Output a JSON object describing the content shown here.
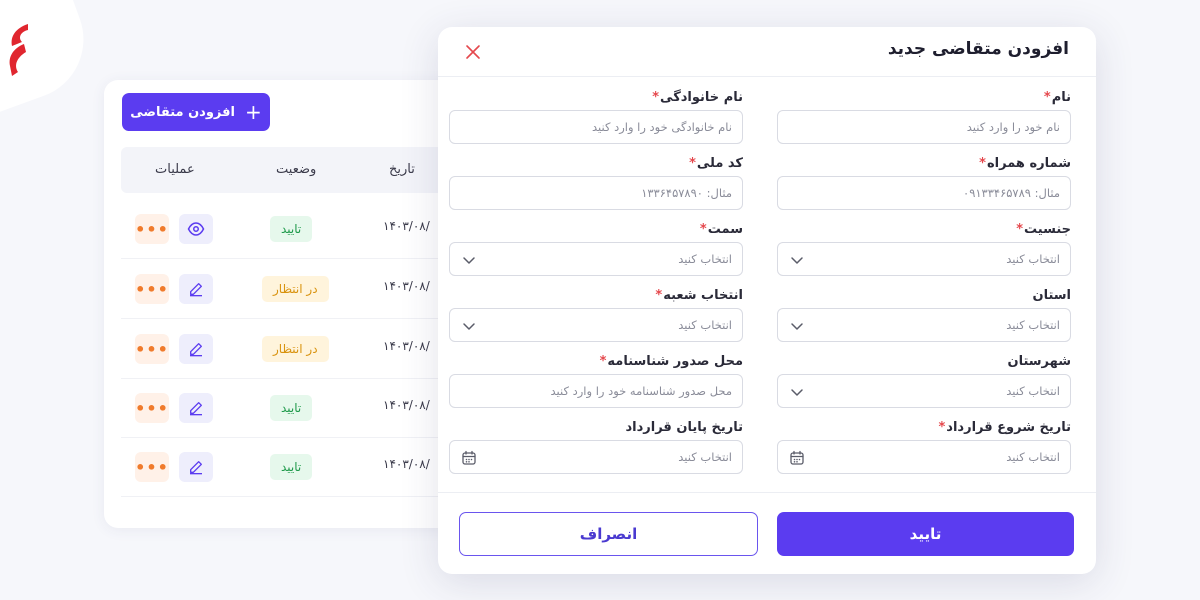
{
  "toolbar": {
    "add_label": "افزودن متقاضی"
  },
  "table": {
    "headers": {
      "ops": "عملیات",
      "status": "وضعیت",
      "date": "تاریخ"
    },
    "rows": [
      {
        "status": "تایید",
        "status_type": "ok",
        "date": "۱۴۰۳/۰۸/",
        "action_icon": "eye-icon"
      },
      {
        "status": "در انتظار",
        "status_type": "wait",
        "date": "۱۴۰۳/۰۸/",
        "action_icon": "edit-icon"
      },
      {
        "status": "در انتظار",
        "status_type": "wait",
        "date": "۱۴۰۳/۰۸/",
        "action_icon": "edit-icon"
      },
      {
        "status": "تایید",
        "status_type": "ok",
        "date": "۱۴۰۳/۰۸/",
        "action_icon": "edit-icon"
      },
      {
        "status": "تایید",
        "status_type": "ok",
        "date": "۱۴۰۳/۰۸/",
        "action_icon": "edit-icon"
      }
    ],
    "more_glyph": "•••"
  },
  "modal": {
    "title": "افزودن متقاضی جدید",
    "fields": {
      "first_name": {
        "label": "نام",
        "placeholder": "نام خود را وارد کنید"
      },
      "last_name": {
        "label": "نام خانوادگی",
        "placeholder": "نام خانوادگی خود را وارد کنید"
      },
      "mobile": {
        "label": "شماره همراه",
        "placeholder": "مثال: ۰۹۱۳۳۴۶۵۷۸۹"
      },
      "national_code": {
        "label": "کد ملی",
        "placeholder": "مثال: ۱۳۳۶۴۵۷۸۹۰"
      },
      "gender": {
        "label": "جنسیت",
        "placeholder": "انتخاب کنید"
      },
      "position": {
        "label": "سمت",
        "placeholder": "انتخاب کنید"
      },
      "province": {
        "label": "استان",
        "placeholder": "انتخاب کنید"
      },
      "branch": {
        "label": "انتخاب شعبه",
        "placeholder": "انتخاب کنید"
      },
      "city": {
        "label": "شهرستان",
        "placeholder": "انتخاب کنید"
      },
      "id_issue_place": {
        "label": "محل صدور شناسنامه",
        "placeholder": "محل صدور شناسنامه خود را وارد کنید"
      },
      "contract_start": {
        "label": "تاریخ شروع قرارداد",
        "placeholder": "انتخاب کنید"
      },
      "contract_end": {
        "label": "تاریخ پایان قرارداد",
        "placeholder": "انتخاب کنید"
      }
    },
    "required_mark": "*",
    "confirm_label": "تایید",
    "cancel_label": "انصراف"
  },
  "colors": {
    "accent": "#5b3cf0",
    "brand": "#e0262f"
  }
}
